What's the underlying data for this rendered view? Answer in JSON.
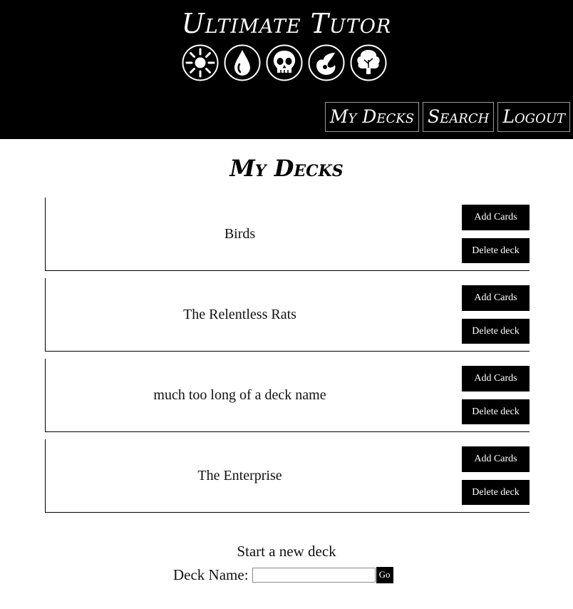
{
  "header": {
    "site_title": "Ultimate Tutor",
    "mana_icons": [
      "white-sun-icon",
      "blue-water-icon",
      "black-skull-icon",
      "red-fire-icon",
      "green-tree-icon"
    ]
  },
  "nav": {
    "my_decks": "My Decks",
    "search": "Search",
    "logout": "Logout"
  },
  "page": {
    "title": "My Decks"
  },
  "decks": [
    {
      "name": "Birds",
      "add_label": "Add Cards",
      "delete_label": "Delete deck"
    },
    {
      "name": "The Relentless Rats",
      "add_label": "Add Cards",
      "delete_label": "Delete deck"
    },
    {
      "name": "much too long of a deck name",
      "add_label": "Add Cards",
      "delete_label": "Delete deck"
    },
    {
      "name": "The Enterprise",
      "add_label": "Add Cards",
      "delete_label": "Delete deck"
    }
  ],
  "new_deck": {
    "title": "Start a new deck",
    "label": "Deck Name:",
    "input_value": "",
    "go_label": "Go"
  }
}
